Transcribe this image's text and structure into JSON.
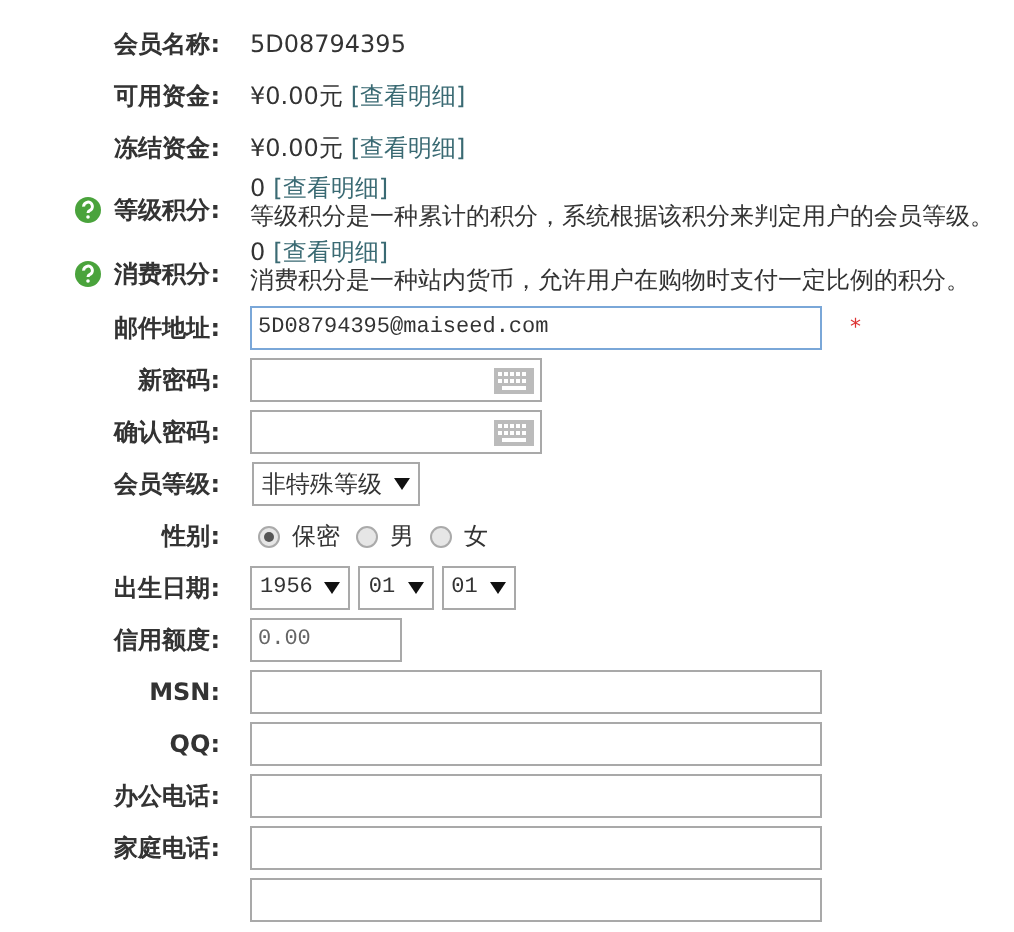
{
  "rows": [
    {
      "kind": "text",
      "label": "会员名称:",
      "value": "5D08794395"
    },
    {
      "kind": "text",
      "label": "可用资金:",
      "value": "¥0.00元",
      "link": "[查看明细]"
    },
    {
      "kind": "text",
      "label": "冻结资金:",
      "value": "¥0.00元",
      "link": "[查看明细]"
    },
    {
      "kind": "points",
      "label": "等级积分:",
      "value": "0",
      "link": "[查看明细]",
      "note": "等级积分是一种累计的积分，系统根据该积分来判定用户的会员等级。"
    },
    {
      "kind": "points",
      "label": "消费积分:",
      "value": "0",
      "link": "[查看明细]",
      "note": "消费积分是一种站内货币，允许用户在购物时支付一定比例的积分。"
    },
    {
      "kind": "email",
      "label": "邮件地址:",
      "value": "5D08794395@maiseed.com",
      "required": "*"
    },
    {
      "kind": "password",
      "label": "新密码:"
    },
    {
      "kind": "password",
      "label": "确认密码:"
    },
    {
      "kind": "select",
      "label": "会员等级:",
      "value": "非特殊等级"
    },
    {
      "kind": "radio",
      "label": "性别:",
      "options": [
        {
          "label": "保密",
          "selected": true
        },
        {
          "label": "男",
          "selected": false
        },
        {
          "label": "女",
          "selected": false
        }
      ]
    },
    {
      "kind": "dates",
      "label": "出生日期:",
      "values": [
        "1956",
        "01",
        "01"
      ]
    },
    {
      "kind": "short",
      "label": "信用额度:",
      "value": "0.00"
    },
    {
      "kind": "input",
      "label": "MSN:"
    },
    {
      "kind": "input",
      "label": "QQ:"
    },
    {
      "kind": "input",
      "label": "办公电话:"
    },
    {
      "kind": "input",
      "label": "家庭电话:"
    },
    {
      "kind": "input"
    }
  ]
}
